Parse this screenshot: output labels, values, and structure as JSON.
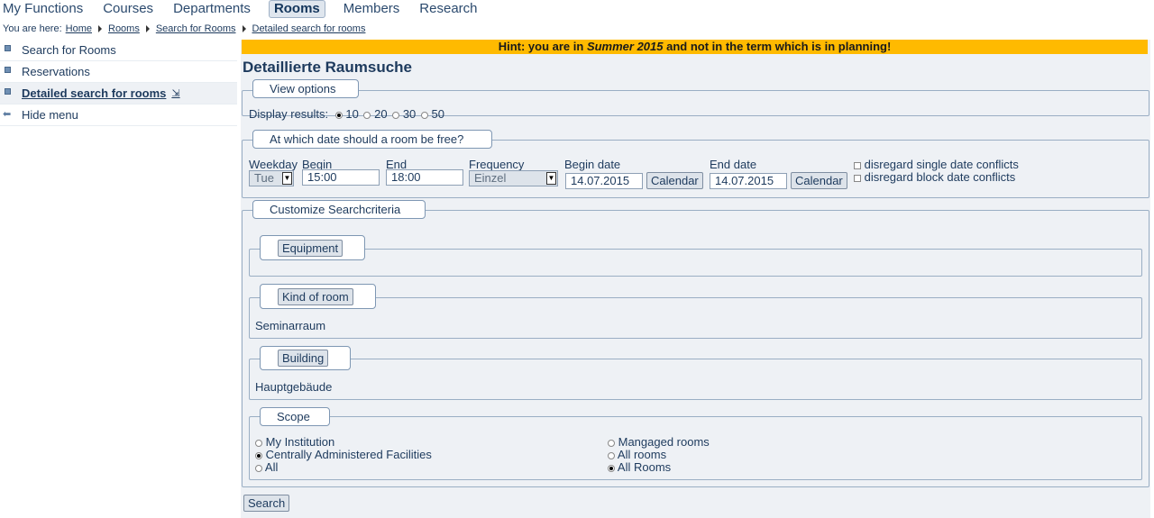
{
  "topnav": {
    "items": [
      {
        "label": "My Functions"
      },
      {
        "label": "Courses"
      },
      {
        "label": "Departments"
      },
      {
        "label": "Rooms"
      },
      {
        "label": "Members"
      },
      {
        "label": "Research"
      }
    ],
    "active": "Rooms"
  },
  "breadcrumb": {
    "prefix": "You are here:",
    "items": [
      "Home",
      "Rooms",
      "Search for Rooms",
      "Detailed search for rooms"
    ]
  },
  "sidebar": {
    "items": [
      {
        "label": "Search for Rooms"
      },
      {
        "label": "Reservations"
      },
      {
        "label": "Detailed search for rooms"
      },
      {
        "label": "Hide menu"
      }
    ]
  },
  "hint": {
    "before": "Hint: you are in ",
    "term": "Summer 2015",
    "after": " and not in the term which is in planning!"
  },
  "page_title": "Detaillierte Raumsuche",
  "view_options": {
    "legend": "View options",
    "label": "Display results:",
    "options": [
      "10",
      "20",
      "30",
      "50"
    ],
    "selected": "10"
  },
  "date_section": {
    "legend": "At which date should a room be free?",
    "weekday_label": "Weekday",
    "weekday_value": "Tue",
    "begin_label": "Begin",
    "begin_value": "15:00",
    "end_label": "End",
    "end_value": "18:00",
    "frequency_label": "Frequency",
    "frequency_value": "Einzel",
    "begin_date_label": "Begin date",
    "begin_date_value": "14.07.2015",
    "end_date_label": "End date",
    "end_date_value": "14.07.2015",
    "calendar_label": "Calendar",
    "disregard_single": "disregard single date conflicts",
    "disregard_block": "disregard block date conflicts"
  },
  "criteria": {
    "legend": "Customize Searchcriteria",
    "equipment_button": "Equipment",
    "equipment_value": "",
    "kind_button": "Kind of room",
    "kind_value": "Seminarraum",
    "building_button": "Building",
    "building_value": "Hauptgebäude",
    "scope_legend": "Scope",
    "scope_left": [
      {
        "label": "My Institution",
        "selected": false
      },
      {
        "label": "Centrally Administered Facilities",
        "selected": true
      },
      {
        "label": "All",
        "selected": false
      }
    ],
    "scope_right": [
      {
        "label": "Mangaged rooms",
        "selected": false
      },
      {
        "label": "All rooms",
        "selected": false
      },
      {
        "label": "All Rooms",
        "selected": true
      }
    ]
  },
  "search_button": "Search",
  "colors": {
    "hint_bg": "#ffba00",
    "text": "#1d3a5d",
    "panel_bg": "#eef1f5"
  }
}
